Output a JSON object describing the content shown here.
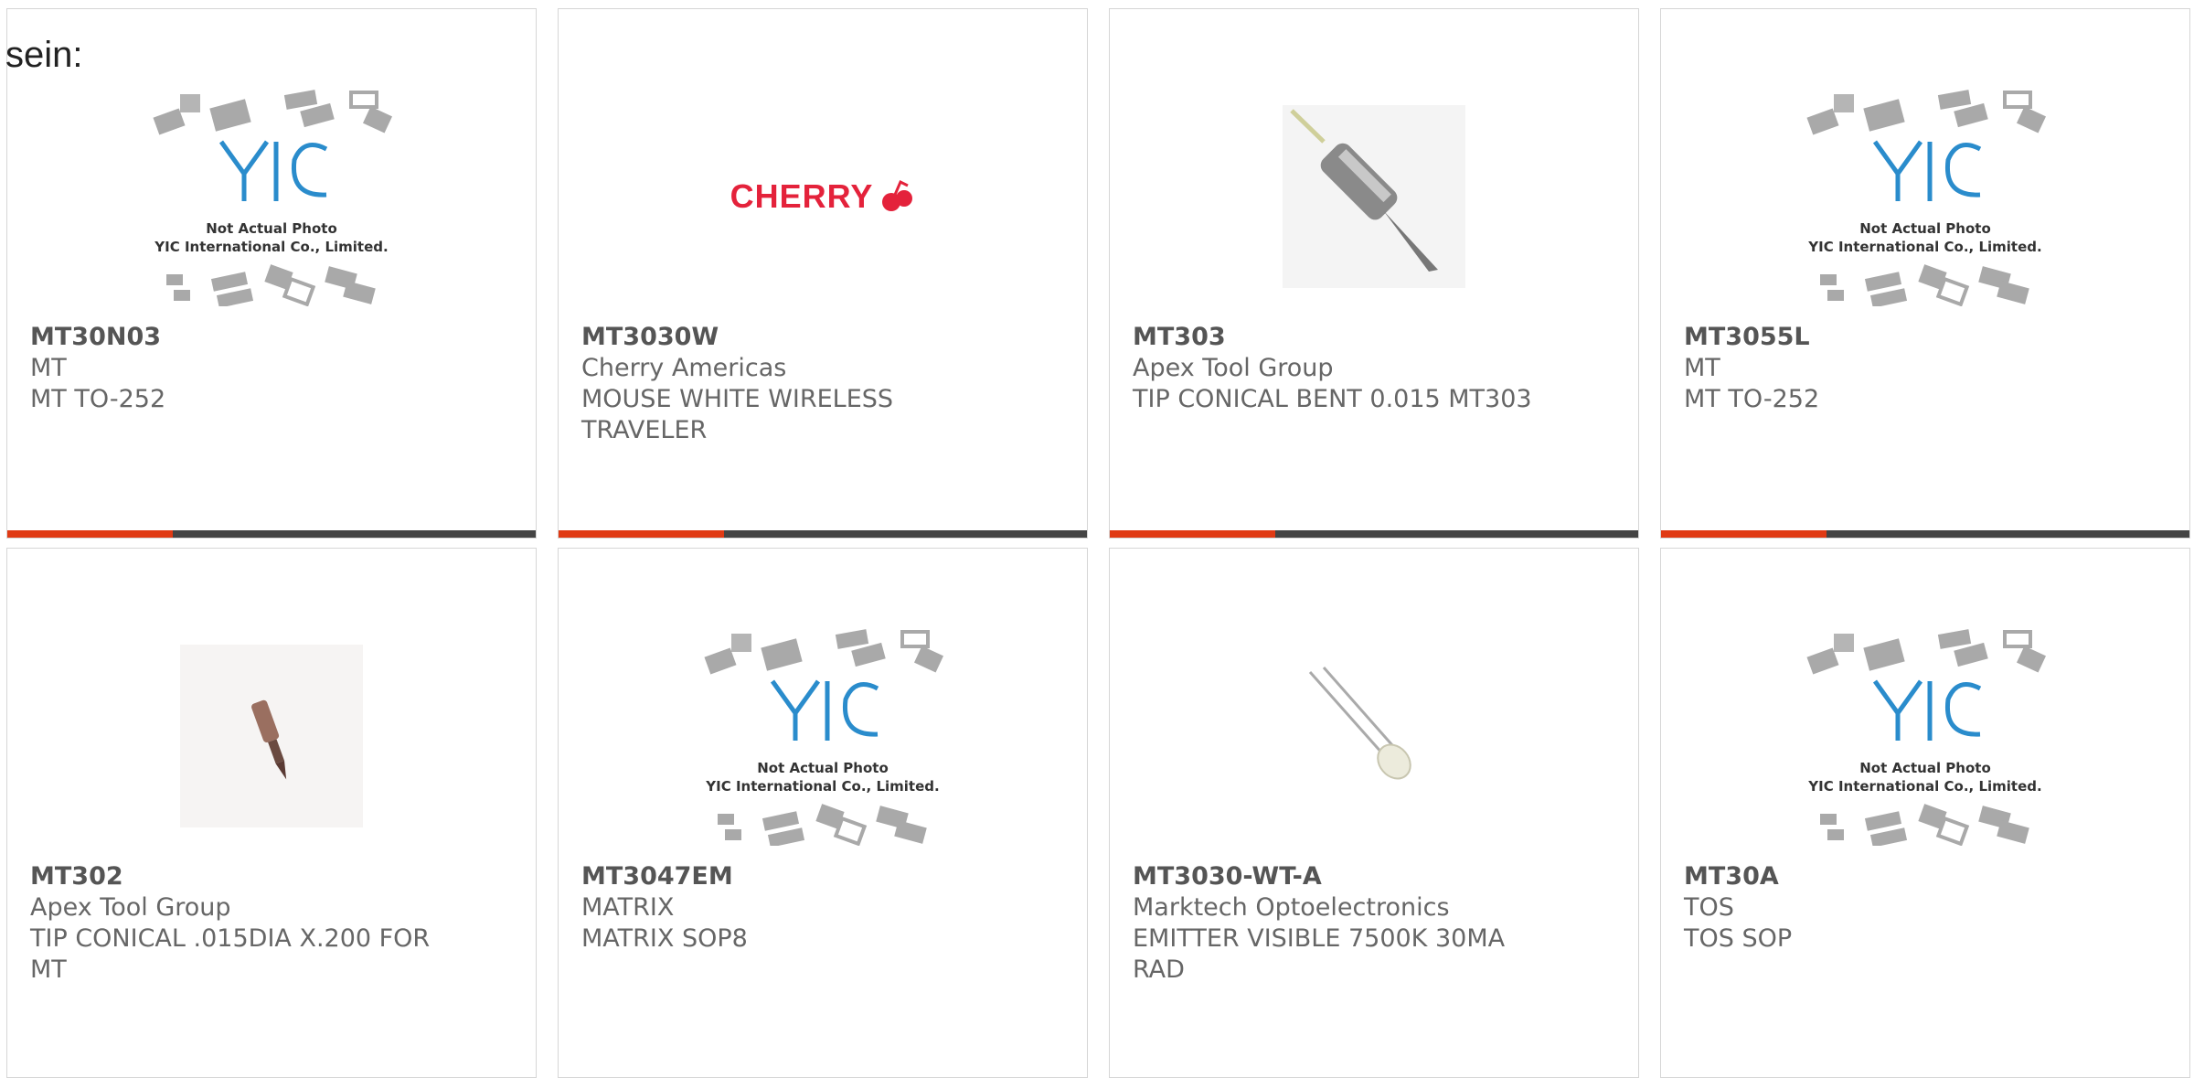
{
  "heading": "sein:",
  "colors": {
    "accent": "#e03a14",
    "bar": "#444444",
    "cherry": "#e4223b",
    "yic_blue": "#2a8ccc"
  },
  "placeholder": {
    "line1": "Not Actual Photo",
    "line2": "YIC International Co., Limited."
  },
  "cherry_logo_text": "CHERRY",
  "products": [
    {
      "part": "MT30N03",
      "manufacturer": "MT",
      "description": "MT TO-252",
      "image": "yic-placeholder"
    },
    {
      "part": "MT3030W",
      "manufacturer": "Cherry Americas",
      "description": "MOUSE WHITE WIRELESS TRAVELER",
      "image": "cherry-logo"
    },
    {
      "part": "MT303",
      "manufacturer": "Apex Tool Group",
      "description": "TIP CONICAL BENT 0.015 MT303",
      "image": "solder-tip"
    },
    {
      "part": "MT3055L",
      "manufacturer": "MT",
      "description": "MT TO-252",
      "image": "yic-placeholder"
    },
    {
      "part": "MT302",
      "manufacturer": "Apex Tool Group",
      "description": "TIP CONICAL .015DIA X.200 FOR MT",
      "image": "small-tip"
    },
    {
      "part": "MT3047EM",
      "manufacturer": "MATRIX",
      "description": "MATRIX SOP8",
      "image": "yic-placeholder"
    },
    {
      "part": "MT3030-WT-A",
      "manufacturer": "Marktech Optoelectronics",
      "description": "EMITTER VISIBLE 7500K 30MA RAD",
      "image": "led"
    },
    {
      "part": "MT30A",
      "manufacturer": "TOS",
      "description": "TOS SOP",
      "image": "yic-placeholder"
    }
  ]
}
